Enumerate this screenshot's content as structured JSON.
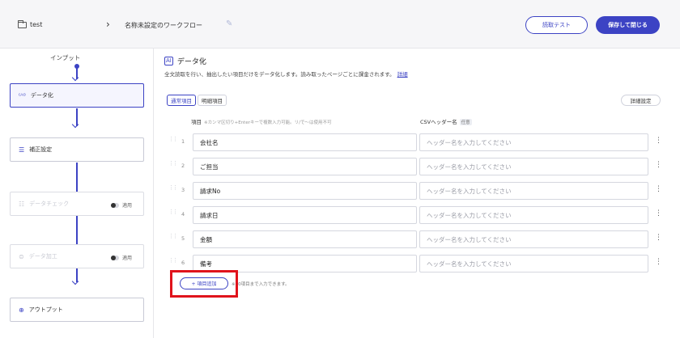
{
  "header": {
    "folder": "test",
    "title": "名称未設定のワークフロー",
    "test_button": "読取テスト",
    "save_button": "保存して閉じる"
  },
  "flow": {
    "input_label": "インプット",
    "nodes": [
      {
        "label": "データ化",
        "icon": "ai-icon"
      },
      {
        "label": "補正設定",
        "icon": "correction-icon"
      },
      {
        "label": "データチェック",
        "icon": "list-icon",
        "toggle": "適用"
      },
      {
        "label": "データ加工",
        "icon": "process-icon",
        "toggle": "適用"
      },
      {
        "label": "アウトプット",
        "icon": "output-icon"
      }
    ]
  },
  "panel": {
    "title": "データ化",
    "description": "全文読取を行い、抽出したい項目だけをデータ化します。読み取ったページごとに課金されます。",
    "detail_link": "詳細",
    "tabs": [
      "通常項目",
      "明細項目"
    ],
    "detail_settings": "詳細設定",
    "col_item": "項目",
    "col_item_hint": "※カンマ区切り+Enterキーで複数入力可能。リ/で〜は使用不可",
    "col_csv": "CSVヘッダー名",
    "col_csv_tag": "任意",
    "rows": [
      {
        "num": "1",
        "name": "会社名",
        "csv_placeholder": "ヘッダー名を入力してください"
      },
      {
        "num": "2",
        "name": "ご担当",
        "csv_placeholder": "ヘッダー名を入力してください"
      },
      {
        "num": "3",
        "name": "請求No",
        "csv_placeholder": "ヘッダー名を入力してください"
      },
      {
        "num": "4",
        "name": "請求日",
        "csv_placeholder": "ヘッダー名を入力してください"
      },
      {
        "num": "5",
        "name": "金額",
        "csv_placeholder": "ヘッダー名を入力してください"
      },
      {
        "num": "6",
        "name": "備考",
        "csv_placeholder": "ヘッダー名を入力してください"
      }
    ],
    "add_button": "+ 項目追加",
    "add_note": "※50項目まで入力できます。"
  },
  "colors": {
    "accent": "#3c43c4",
    "highlight": "#e0131b"
  }
}
